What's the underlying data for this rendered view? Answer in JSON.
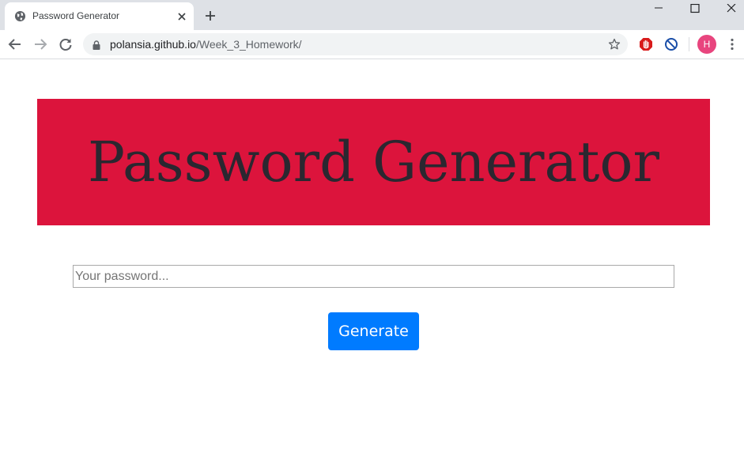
{
  "browser": {
    "tab": {
      "title": "Password Generator",
      "favicon": "globe-icon"
    },
    "address": {
      "host": "polansia.github.io",
      "path": "/Week_3_Homework/"
    },
    "profile_initial": "H",
    "colors": {
      "profile": "#e8457e",
      "extension_red": "#d81b1b",
      "extension_blue": "#1a4ea8"
    }
  },
  "page": {
    "title": "Password Generator",
    "password": {
      "value": "",
      "placeholder": "Your password..."
    },
    "generate_label": "Generate",
    "colors": {
      "banner": "#dc143c",
      "title_text": "#2b2730",
      "button": "#007bff"
    }
  }
}
